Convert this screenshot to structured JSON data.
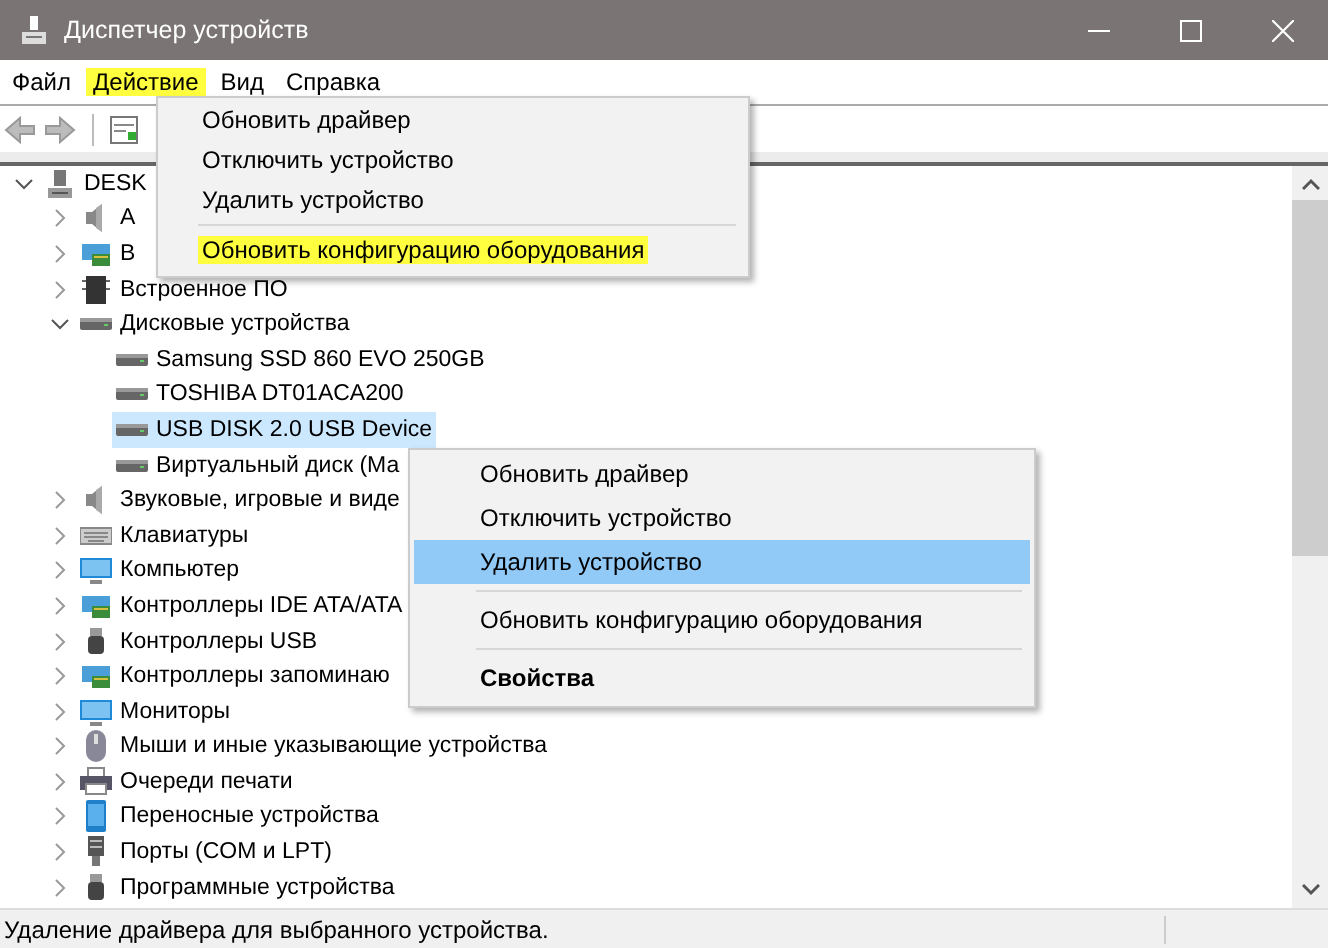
{
  "window": {
    "title": "Диспетчер устройств"
  },
  "menu_bar": [
    {
      "label": "Файл",
      "selected": false
    },
    {
      "label": "Действие",
      "selected": true
    },
    {
      "label": "Вид",
      "selected": false
    },
    {
      "label": "Справка",
      "selected": false
    }
  ],
  "tree": [
    {
      "label": "DESK",
      "kind": "computer",
      "expanded": true,
      "selected": false,
      "children": [
        {
          "label": "А",
          "kind": "speaker",
          "expanded": false,
          "selected": false
        },
        {
          "label": "В",
          "kind": "network",
          "expanded": false,
          "selected": false
        },
        {
          "label": "Встроенное ПО",
          "kind": "chip",
          "expanded": false,
          "selected": false
        },
        {
          "label": "Дисковые устройства",
          "kind": "disk",
          "expanded": true,
          "selected": false,
          "children": [
            {
              "label": "Samsung SSD 860 EVO 250GB",
              "kind": "disk",
              "selected": false
            },
            {
              "label": "TOSHIBA DT01ACA200",
              "kind": "disk",
              "selected": false
            },
            {
              "label": "USB DISK 2.0 USB Device",
              "kind": "disk",
              "selected": true
            },
            {
              "label": "Виртуальный диск (Ма",
              "kind": "disk",
              "selected": false
            }
          ]
        },
        {
          "label": "Звуковые, игровые и виде",
          "kind": "speaker",
          "expanded": false,
          "selected": false
        },
        {
          "label": "Клавиатуры",
          "kind": "keyboard",
          "expanded": false,
          "selected": false
        },
        {
          "label": "Компьютер",
          "kind": "monitor",
          "expanded": false,
          "selected": false
        },
        {
          "label": "Контроллеры IDE ATA/ATA",
          "kind": "network",
          "expanded": false,
          "selected": false
        },
        {
          "label": "Контроллеры USB",
          "kind": "usb",
          "expanded": false,
          "selected": false
        },
        {
          "label": "Контроллеры запоминаю",
          "kind": "network",
          "expanded": false,
          "selected": false
        },
        {
          "label": "Мониторы",
          "kind": "monitor",
          "expanded": false,
          "selected": false
        },
        {
          "label": "Мыши и иные указывающие устройства",
          "kind": "mouse",
          "expanded": false,
          "selected": false
        },
        {
          "label": "Очереди печати",
          "kind": "printer",
          "expanded": false,
          "selected": false
        },
        {
          "label": "Переносные устройства",
          "kind": "portable",
          "expanded": false,
          "selected": false
        },
        {
          "label": "Порты (COM и LPT)",
          "kind": "port",
          "expanded": false,
          "selected": false
        },
        {
          "label": "Программные устройства",
          "kind": "usb",
          "expanded": false,
          "selected": false
        }
      ]
    }
  ],
  "action_menu": [
    {
      "label": "Обновить драйвер",
      "separator_before": false,
      "highlighted": false
    },
    {
      "label": "Отключить устройство",
      "separator_before": false,
      "highlighted": false
    },
    {
      "label": "Удалить устройство",
      "separator_before": false,
      "highlighted": false
    },
    {
      "label": "Обновить конфигурацию оборудования",
      "separator_before": true,
      "highlighted": true
    }
  ],
  "context_menu": [
    {
      "label": "Обновить драйвер",
      "separator_before": false,
      "selected": false,
      "bold": false
    },
    {
      "label": "Отключить устройство",
      "separator_before": false,
      "selected": false,
      "bold": false
    },
    {
      "label": "Удалить устройство",
      "separator_before": false,
      "selected": true,
      "bold": false
    },
    {
      "label": "Обновить конфигурацию оборудования",
      "separator_before": true,
      "selected": false,
      "bold": false
    },
    {
      "label": "Свойства",
      "separator_before": true,
      "selected": false,
      "bold": true
    }
  ],
  "status_bar": {
    "text": "Удаление драйвера для выбранного устройства."
  }
}
